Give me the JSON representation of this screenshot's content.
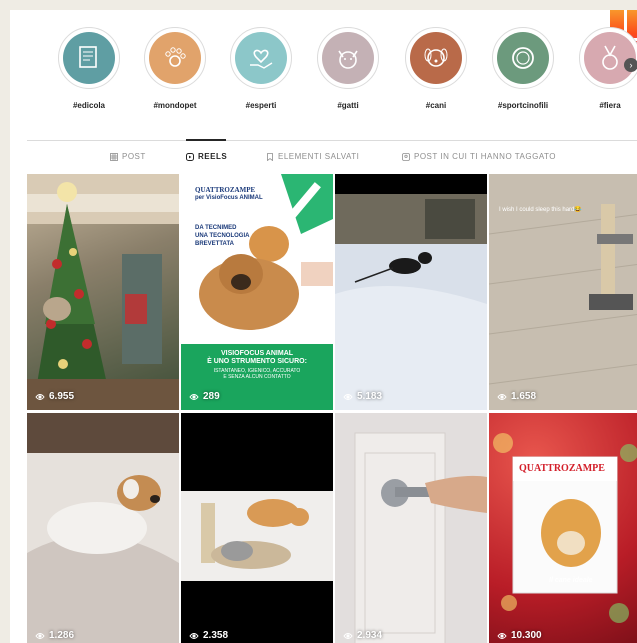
{
  "highlights": [
    {
      "label": "#edicola",
      "color": "#5f9ea3",
      "icon": "newspaper-icon"
    },
    {
      "label": "#mondopet",
      "color": "#e1a36b",
      "icon": "paw-icon"
    },
    {
      "label": "#esperti",
      "color": "#8cc7c9",
      "icon": "hand-heart-icon"
    },
    {
      "label": "#gatti",
      "color": "#c4b1b5",
      "icon": "cat-icon"
    },
    {
      "label": "#cani",
      "color": "#b96a49",
      "icon": "dog-icon"
    },
    {
      "label": "#sportcinofili",
      "color": "#6c9a7d",
      "icon": "ring-icon"
    },
    {
      "label": "#fiera",
      "color": "#d7a9b0",
      "icon": "medal-icon"
    }
  ],
  "tabs": [
    {
      "label": "POST",
      "icon": "grid-icon",
      "active": false
    },
    {
      "label": "REELS",
      "icon": "reels-icon",
      "active": true
    },
    {
      "label": "ELEMENTI SALVATI",
      "icon": "bookmark-icon",
      "active": false
    },
    {
      "label": "POST IN CUI TI HANNO TAGGATO",
      "icon": "tag-icon",
      "active": false
    }
  ],
  "reels": [
    {
      "views": "6.955",
      "scene": "christmas-tree-cat"
    },
    {
      "views": "289",
      "scene": "visiofocus-ad",
      "brand": "QUATTROZAMPE",
      "subtitle": "per VisioFocus ANIMAL",
      "headline": "DA TECNIMED\nUNA TECNOLOGIA\nBREVETTATA",
      "title": "VISIOFOCUS ANIMAL\nÈ UNO STRUMENTO SICURO:",
      "caption": "ISTANTANEO, IGIENICO, ACCURATO\nE SENZA ALCUN CONTATTO"
    },
    {
      "views": "5.183",
      "scene": "dog-in-snow"
    },
    {
      "views": "1.658",
      "scene": "cat-tree",
      "caption": "I wish I could sleep this hard😂"
    },
    {
      "views": "1.286",
      "scene": "dog-on-bed"
    },
    {
      "views": "2.358",
      "scene": "cats-in-bed-tree"
    },
    {
      "views": "2.934",
      "scene": "door-handle"
    },
    {
      "views": "10.300",
      "scene": "magazine-cover",
      "brand": "QUATTROZAMPE",
      "cover_text": "Il cane ideale"
    }
  ]
}
